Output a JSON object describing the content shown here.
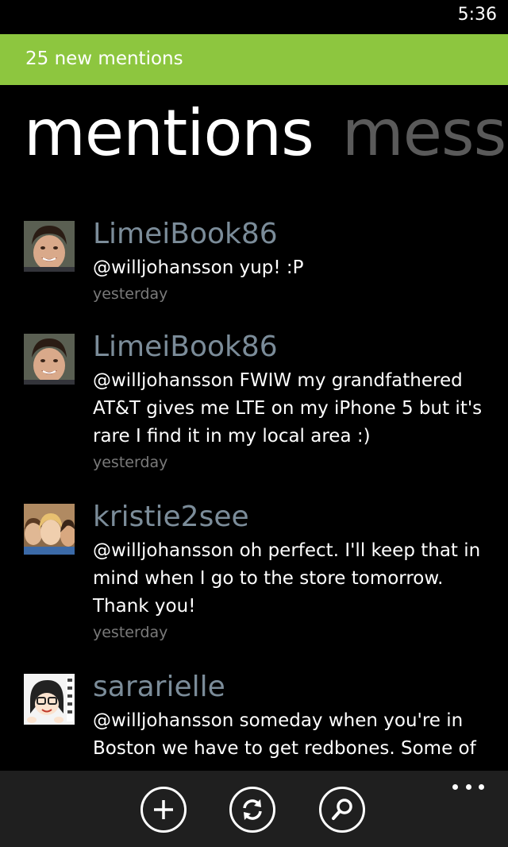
{
  "status_bar": {
    "time": "5:36"
  },
  "notification": {
    "text": "25 new mentions"
  },
  "pivot": {
    "active": "mentions",
    "next": "mess"
  },
  "mentions": [
    {
      "username": "LimeiBook86",
      "lines": [
        "@willjohansson yup! :P"
      ],
      "time": "yesterday",
      "avatar_icon": "man-face-avatar"
    },
    {
      "username": "LimeiBook86",
      "lines": [
        "@willjohansson FWIW my grandfathered",
        "AT&T gives me LTE on my iPhone 5 but it's",
        "rare I find it in my local area :)"
      ],
      "time": "yesterday",
      "avatar_icon": "man-face-avatar"
    },
    {
      "username": "kristie2see",
      "lines": [
        "@willjohansson oh perfect.  I'll keep that in",
        "mind when I go to the store tomorrow.",
        "Thank you!"
      ],
      "time": "yesterday",
      "avatar_icon": "group-faces-avatar"
    },
    {
      "username": "sararielle",
      "lines": [
        "@willjohansson someday when you're in",
        "Boston we have to get redbones. Some of"
      ],
      "time": "",
      "avatar_icon": "cartoon-avatar"
    }
  ],
  "app_bar": {
    "buttons": [
      {
        "name": "compose",
        "icon": "plus-icon"
      },
      {
        "name": "refresh",
        "icon": "refresh-icon"
      },
      {
        "name": "search",
        "icon": "search-icon"
      }
    ],
    "more_icon": "more-dots-icon"
  },
  "colors": {
    "notification_bg": "#8dc63f",
    "username": "#7b8c99",
    "timestamp": "#7a7a7a",
    "inactive_pivot": "#5a5a5a",
    "app_bar_bg": "#1f1f1f"
  }
}
